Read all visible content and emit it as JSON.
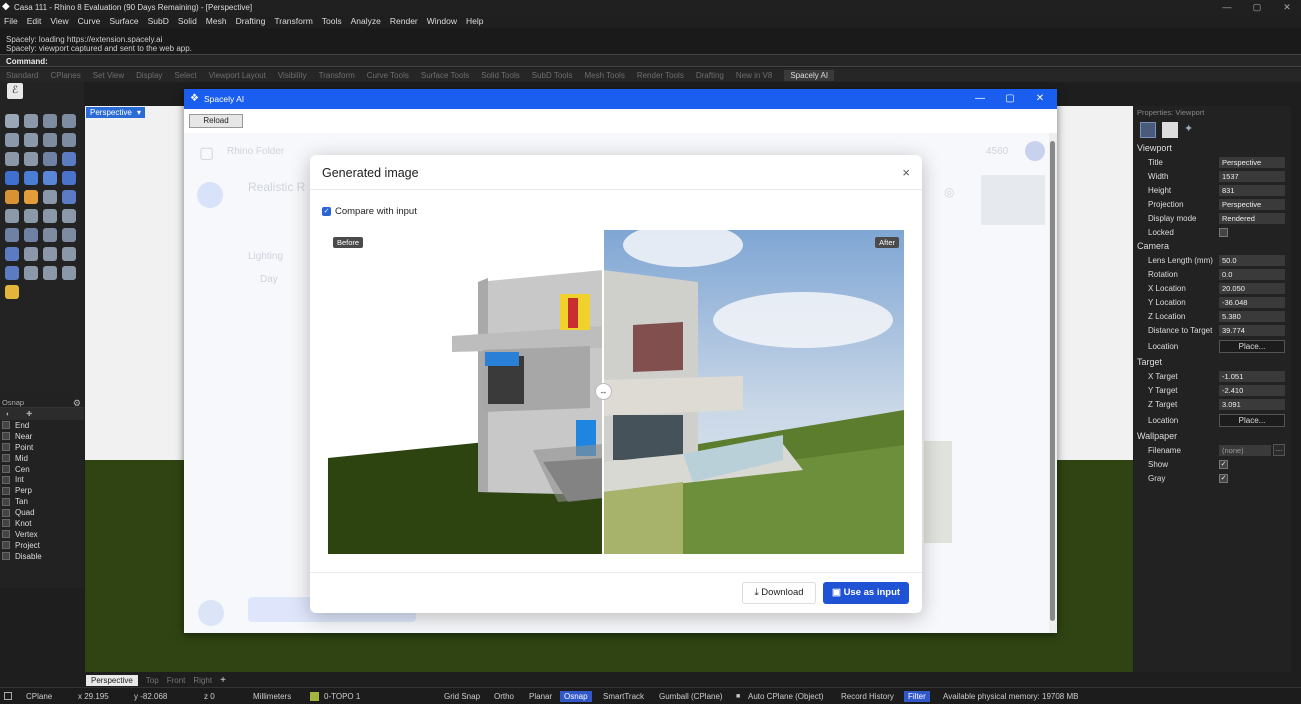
{
  "window_title": "Casa 111 - Rhino 8 Evaluation (90 Days Remaining) - [Perspective]",
  "menu": [
    "File",
    "Edit",
    "View",
    "Curve",
    "Surface",
    "SubD",
    "Solid",
    "Mesh",
    "Drafting",
    "Transform",
    "Tools",
    "Analyze",
    "Render",
    "Window",
    "Help"
  ],
  "history": [
    "Spacely: loading https://extension.spacely.ai",
    "Spacely: viewport captured and sent to the web app."
  ],
  "command_label": "Command:",
  "toolbar_tabs": [
    "Standard",
    "CPlanes",
    "Set View",
    "Display",
    "Select",
    "Viewport Layout",
    "Visibility",
    "Transform",
    "Curve Tools",
    "Surface Tools",
    "Solid Tools",
    "SubD Tools",
    "Mesh Tools",
    "Render Tools",
    "Drafting",
    "New in V8",
    "Spacely AI"
  ],
  "viewport": {
    "active_tab": "Perspective",
    "tabs": [
      "Perspective",
      "Top",
      "Front",
      "Right"
    ],
    "add": "+"
  },
  "osnap": {
    "title": "Osnap",
    "items": [
      "End",
      "Near",
      "Point",
      "Mid",
      "Cen",
      "Int",
      "Perp",
      "Tan",
      "Quad",
      "Knot",
      "Vertex",
      "Project",
      "Disable"
    ]
  },
  "properties": {
    "title": "Properties: Viewport",
    "viewport_section": "Viewport",
    "viewport_rows": [
      {
        "label": "Title",
        "value": "Perspective"
      },
      {
        "label": "Width",
        "value": "1537"
      },
      {
        "label": "Height",
        "value": "831"
      },
      {
        "label": "Projection",
        "value": "Perspective"
      },
      {
        "label": "Display mode",
        "value": "Rendered"
      }
    ],
    "locked_label": "Locked",
    "camera_section": "Camera",
    "camera_rows": [
      {
        "label": "Lens Length (mm)",
        "value": "50.0"
      },
      {
        "label": "Rotation",
        "value": "0.0"
      },
      {
        "label": "X Location",
        "value": "20.050"
      },
      {
        "label": "Y Location",
        "value": "-36.048"
      },
      {
        "label": "Z Location",
        "value": "5.380"
      },
      {
        "label": "Distance to Target",
        "value": "39.774"
      }
    ],
    "location_label": "Location",
    "place_button": "Place...",
    "target_section": "Target",
    "target_rows": [
      {
        "label": "X Target",
        "value": "-1.051"
      },
      {
        "label": "Y Target",
        "value": "-2.410"
      },
      {
        "label": "Z Target",
        "value": "3.091"
      }
    ],
    "wallpaper_section": "Wallpaper",
    "filename_label": "Filename",
    "filename_value": "(none)",
    "show_label": "Show",
    "gray_label": "Gray"
  },
  "spacely": {
    "window_title": "Spacely AI",
    "reload": "Reload",
    "bg_texts": {
      "folder": "Rhino Folder",
      "mode": "Realistic R",
      "lighting": "Lighting",
      "day": "Day",
      "credits": "4560"
    },
    "modal": {
      "title": "Generated image",
      "close": "×",
      "compare_label": "Compare with input",
      "before": "Before",
      "after": "After",
      "download": "Download",
      "use_as_input": "Use as input"
    }
  },
  "status": {
    "cplane": "CPlane",
    "x": "x 29.195",
    "y": "y -82.068",
    "z": "z 0",
    "units": "Millimeters",
    "layer": "0-TOPO 1",
    "grid_snap": "Grid Snap",
    "ortho": "Ortho",
    "planar": "Planar",
    "osnap": "Osnap",
    "smarttrack": "SmartTrack",
    "gumball": "Gumball (CPlane)",
    "autocplane": "Auto CPlane (Object)",
    "record": "Record History",
    "filter": "Filter",
    "memory": "Available physical memory: 19708 MB"
  },
  "colors": {
    "accent": "#1a5ef0",
    "ground": "#2f4412"
  }
}
